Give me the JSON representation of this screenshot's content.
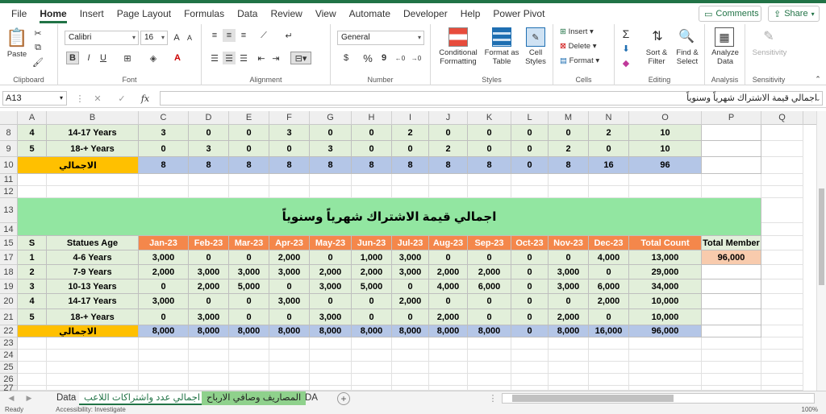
{
  "menu": {
    "tabs": [
      "File",
      "Home",
      "Insert",
      "Page Layout",
      "Formulas",
      "Data",
      "Review",
      "View",
      "Automate",
      "Developer",
      "Help",
      "Power Pivot"
    ],
    "active": "Home",
    "comments": "Comments",
    "share": "Share"
  },
  "ribbon": {
    "clipboard": {
      "label": "Clipboard",
      "paste": "Paste"
    },
    "font": {
      "label": "Font",
      "name": "Calibri",
      "size": "16",
      "bold": "B",
      "italic": "I",
      "underline": "U"
    },
    "alignment": {
      "label": "Alignment"
    },
    "number": {
      "label": "Number",
      "format": "General",
      "currency": "$",
      "percent": "%",
      "comma": "9"
    },
    "styles": {
      "label": "Styles",
      "conditional": [
        "Conditional",
        "Formatting"
      ],
      "format_table": [
        "Format as",
        "Table"
      ],
      "cell_styles": [
        "Cell",
        "Styles"
      ]
    },
    "cells": {
      "label": "Cells",
      "insert": "Insert",
      "delete": "Delete",
      "format": "Format"
    },
    "editing": {
      "label": "Editing",
      "sort": [
        "Sort &",
        "Filter"
      ],
      "find": [
        "Find &",
        "Select"
      ]
    },
    "analysis": {
      "label": "Analysis",
      "analyze": [
        "Analyze",
        "Data"
      ]
    },
    "sensitivity": {
      "label": "Sensitivity",
      "btn": "Sensitivity"
    }
  },
  "formula_bar": {
    "name_box": "A13",
    "fx": "fx",
    "content": "اجمالي قيمة الاشتراك شهرياً وسنوياً"
  },
  "columns": [
    "A",
    "B",
    "C",
    "D",
    "E",
    "F",
    "G",
    "H",
    "I",
    "J",
    "K",
    "L",
    "M",
    "N",
    "O",
    "P",
    "Q"
  ],
  "rows_numbers": [
    "8",
    "9",
    "10",
    "11",
    "12",
    "13",
    "14",
    "15",
    "17",
    "18",
    "19",
    "20",
    "21",
    "22",
    "23",
    "24",
    "25",
    "26",
    "27"
  ],
  "table1": {
    "rows": [
      [
        "4",
        "14-17 Years",
        "3",
        "0",
        "0",
        "3",
        "0",
        "0",
        "2",
        "0",
        "0",
        "0",
        "0",
        "2",
        "10"
      ],
      [
        "5",
        "18-+ Years",
        "0",
        "3",
        "0",
        "0",
        "3",
        "0",
        "0",
        "2",
        "0",
        "0",
        "2",
        "0",
        "10"
      ]
    ],
    "total": {
      "label": "الاجمالي",
      "values": [
        "8",
        "8",
        "8",
        "8",
        "8",
        "8",
        "8",
        "8",
        "8",
        "0",
        "8",
        "16",
        "96"
      ]
    }
  },
  "table2": {
    "title": "اجمالي قيمة الاشتراك شهرياً وسنوياً",
    "headers": [
      "S",
      "Statues Age",
      "Jan-23",
      "Feb-23",
      "Mar-23",
      "Apr-23",
      "May-23",
      "Jun-23",
      "Jul-23",
      "Aug-23",
      "Sep-23",
      "Oct-23",
      "Nov-23",
      "Dec-23",
      "Total Count",
      "Total Member"
    ],
    "rows": [
      [
        "1",
        "4-6 Years",
        "3,000",
        "0",
        "0",
        "2,000",
        "0",
        "1,000",
        "3,000",
        "0",
        "0",
        "0",
        "0",
        "4,000",
        "13,000"
      ],
      [
        "2",
        "7-9 Years",
        "2,000",
        "3,000",
        "3,000",
        "3,000",
        "2,000",
        "2,000",
        "3,000",
        "2,000",
        "2,000",
        "0",
        "3,000",
        "0",
        "29,000"
      ],
      [
        "3",
        "10-13 Years",
        "0",
        "2,000",
        "5,000",
        "0",
        "3,000",
        "5,000",
        "0",
        "4,000",
        "6,000",
        "0",
        "3,000",
        "6,000",
        "34,000"
      ],
      [
        "4",
        "14-17 Years",
        "3,000",
        "0",
        "0",
        "3,000",
        "0",
        "0",
        "2,000",
        "0",
        "0",
        "0",
        "0",
        "2,000",
        "10,000"
      ],
      [
        "5",
        "18-+ Years",
        "0",
        "3,000",
        "0",
        "0",
        "3,000",
        "0",
        "0",
        "2,000",
        "0",
        "0",
        "2,000",
        "0",
        "10,000"
      ]
    ],
    "total_member": "96,000",
    "total": {
      "label": "الاجمالي",
      "values": [
        "8,000",
        "8,000",
        "8,000",
        "8,000",
        "8,000",
        "8,000",
        "8,000",
        "8,000",
        "8,000",
        "0",
        "8,000",
        "16,000",
        "96,000"
      ]
    }
  },
  "sheets": [
    "Data",
    "اجمالي عدد  واشتراكات اللاعب",
    "المصاريف وصافي الارباح",
    "DA"
  ],
  "active_sheet": "المصاريف وصافي الارباح",
  "status": {
    "ready": "Ready",
    "accessibility": "Accessibility: Investigate",
    "zoom": "100%"
  },
  "colors": {
    "green": "#e2efda",
    "title_green": "#92e6a1",
    "orange": "#f4874b",
    "gold": "#ffc000",
    "blue": "#b4c6e7",
    "peach": "#f8cbad",
    "excel": "#217346"
  }
}
